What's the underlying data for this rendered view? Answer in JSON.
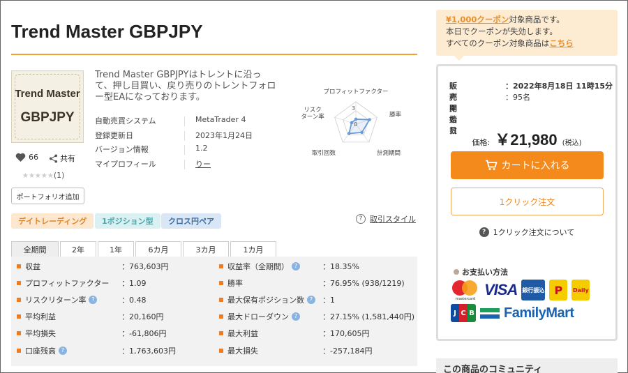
{
  "product": {
    "title": "Trend Master GBPJPY",
    "thumbnail": {
      "line1": "Trend Master",
      "line2": "GBPJPY"
    },
    "favorite_count": "66",
    "share_label": "共有",
    "rating_stars": "★★★★★",
    "review_count": "(1)",
    "portfolio_button": "ポートフォリオ追加",
    "description": "Trend Master GBPJPYはトレントに沿って、押し目買い、戻り売りのトレントフォロー型EAになっております。",
    "meta": [
      {
        "key": "自動売買システム",
        "value": "MetaTrader 4"
      },
      {
        "key": "登録更新日",
        "value": "2023年1月24日"
      },
      {
        "key": "バージョン情報",
        "value": "1.2"
      },
      {
        "key": "マイプロフィール",
        "value": "りー"
      }
    ]
  },
  "radar": {
    "labels": [
      "プロフィットファクター",
      "勝率",
      "計測期間",
      "取引回数",
      "リスク\nターン率"
    ],
    "center_labels": [
      "3",
      "0"
    ],
    "values": [
      1.1,
      3.2,
      2.3,
      2.6,
      1.0
    ],
    "max": 5,
    "color": "#6a9bd8"
  },
  "tags": [
    "デイトレーディング",
    "1ポジション型",
    "クロス円ペア"
  ],
  "style_link": "取引スタイル",
  "tabs": [
    "全期間",
    "2年",
    "1年",
    "6カ月",
    "3カ月",
    "1カ月"
  ],
  "active_tab": "全期間",
  "stats_left": [
    {
      "label": "収益",
      "value": "：763,603円",
      "help": false
    },
    {
      "label": "プロフィットファクター",
      "value": "：1.09",
      "help": false
    },
    {
      "label": "リスクリターン率",
      "value": "：0.48",
      "help": true
    },
    {
      "label": "平均利益",
      "value": "：20,160円",
      "help": false
    },
    {
      "label": "平均損失",
      "value": "：-61,806円",
      "help": false
    },
    {
      "label": "口座残高",
      "value": "：1,763,603円",
      "help": true
    }
  ],
  "stats_right": [
    {
      "label": "収益率（全期間）",
      "value": "：18.35%",
      "help": true
    },
    {
      "label": "勝率",
      "value": "：76.95% (938/1219)",
      "help": false
    },
    {
      "label": "最大保有ポジション数",
      "value": "：1",
      "help": true
    },
    {
      "label": "最大ドローダウン",
      "value": "：27.15% (1,581,440円)",
      "help": true
    },
    {
      "label": "最大利益",
      "value": "：170,605円",
      "help": false
    },
    {
      "label": "最大損失",
      "value": "：-257,184円",
      "help": false
    }
  ],
  "coupon": {
    "link": "¥1,000クーポン",
    "line1_rest": "対象商品です。",
    "line2": "本日でクーポンが失効します。",
    "line3": "すべてのクーポン対象商品は",
    "line3_link": "こちら"
  },
  "purchase": {
    "sale_start_label": "販売開始日",
    "sale_start_value": "：2022年8月18日 11時15分",
    "users_label": "利用者数",
    "users_value": "：95名",
    "price_label": "価格:",
    "price": "￥21,980",
    "tax": "(税込)",
    "cart_button": "カートに入れる",
    "oneclick_button": "1クリック注文",
    "about_oneclick": "1クリック注文について",
    "payment_title": "お支払い方法"
  },
  "payments": {
    "mastercard": "mastercard",
    "visa": "VISA",
    "bank": "銀行振込",
    "payeasy": "P",
    "daily": "Daily",
    "jcb": [
      "J",
      "C",
      "B"
    ],
    "familymart": "FamilyMart"
  },
  "community_title": "この商品のコミュニティ",
  "colors": {
    "accent": "#f48a1b",
    "title_rule": "#f0a030",
    "tag_orange": "#e08427"
  }
}
